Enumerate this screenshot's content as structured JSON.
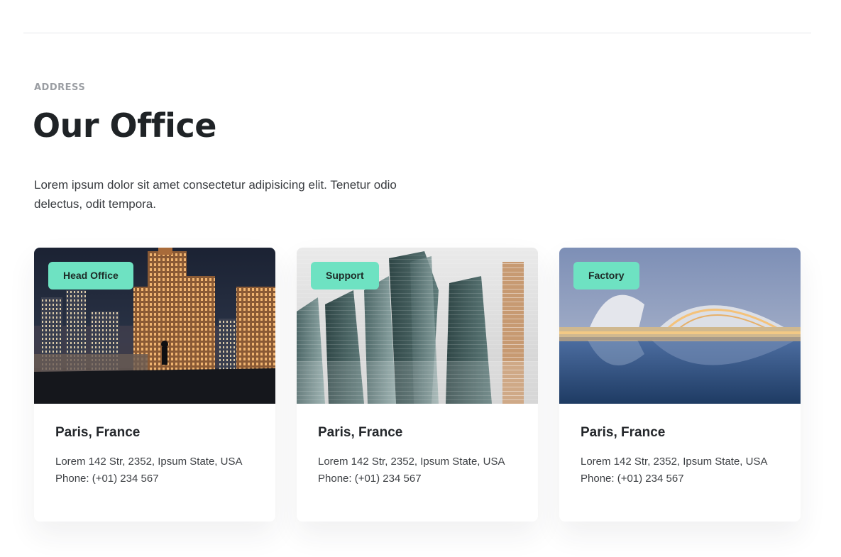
{
  "section": {
    "eyebrow": "ADDRESS",
    "title": "Our Office",
    "description": "Lorem ipsum dolor sit amet consectetur adipisicing elit. Tenetur odio delectus, odit tempora."
  },
  "colors": {
    "badge": "#6ee2c2",
    "title": "#1f2326"
  },
  "offices": [
    {
      "badge": "Head Office",
      "image": "night-city-skyline-with-person-on-rooftop",
      "city": "Paris, France",
      "address": "Lorem 142 Str, 2352, Ipsum State, USA",
      "phone": "Phone: (+01) 234 567"
    },
    {
      "badge": "Support",
      "image": "glass-skyscrapers",
      "city": "Paris, France",
      "address": "Lorem 142 Str, 2352, Ipsum State, USA",
      "phone": "Phone: (+01) 234 567"
    },
    {
      "badge": "Factory",
      "image": "futuristic-building-reflected-in-water",
      "city": "Paris, France",
      "address": "Lorem 142 Str, 2352, Ipsum State, USA",
      "phone": "Phone: (+01) 234 567"
    }
  ]
}
